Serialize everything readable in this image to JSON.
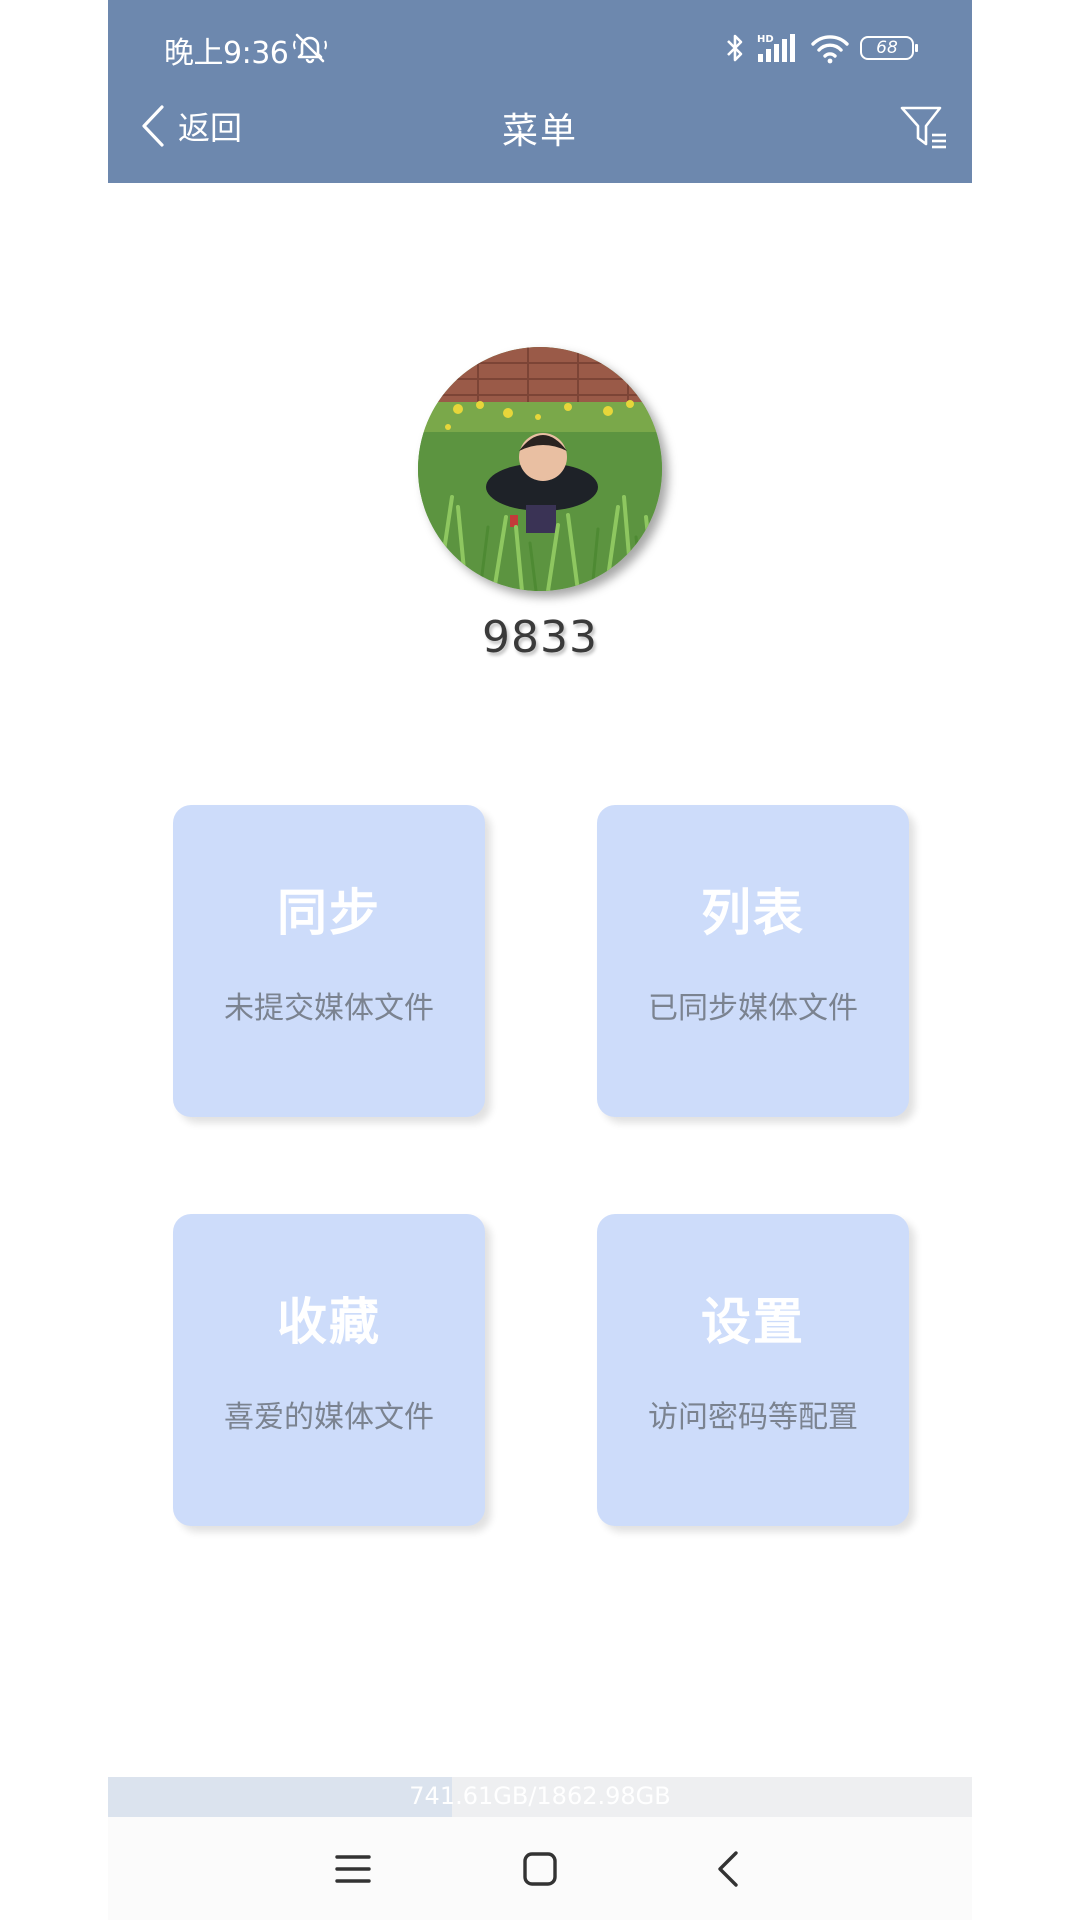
{
  "status_bar": {
    "time": "晚上9:36",
    "battery_level": "68",
    "icons": [
      "mute-icon",
      "bluetooth-icon",
      "hd-signal-icon",
      "wifi-icon",
      "battery-icon"
    ]
  },
  "header": {
    "back_label": "返回",
    "title": "菜单",
    "filter_icon": "filter-list-icon"
  },
  "profile": {
    "name": "9833"
  },
  "menu": [
    {
      "title": "同步",
      "subtitle": "未提交媒体文件"
    },
    {
      "title": "列表",
      "subtitle": "已同步媒体文件"
    },
    {
      "title": "收藏",
      "subtitle": "喜爱的媒体文件"
    },
    {
      "title": "设置",
      "subtitle": "访问密码等配置"
    }
  ],
  "storage": {
    "text": "741.61GB/1862.98GB",
    "used_fraction": 0.398
  },
  "colors": {
    "header_bg": "#6d88ae",
    "card_bg": "#cddcfa",
    "card_subtitle": "#7b8390",
    "storage_fill": "#dbe3ee"
  },
  "nav_bar": {
    "icons": [
      "menu-icon",
      "home-icon",
      "back-icon"
    ]
  }
}
